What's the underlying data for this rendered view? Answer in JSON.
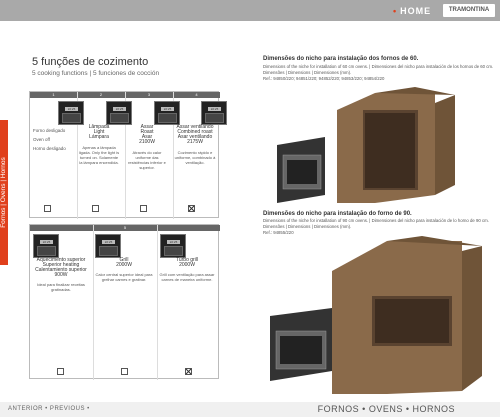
{
  "header": {
    "home_label": "HOME",
    "brand": "TRAMONTINA"
  },
  "side_tab": "Fornos | Ovens | Hornos",
  "section": {
    "title": "5 funções de cozimento",
    "subtitle": "5 cooking functions | 5 funciones de cocción"
  },
  "grid1": {
    "columns": [
      "1",
      "2",
      "3",
      "4"
    ],
    "functions": [
      {
        "name": "Lâmpada",
        "name_en": "Light",
        "name_es": "Lámpara",
        "power": "",
        "desc": "Apenas a lâmpada ligada. Only the light is turned on. Solamente la lámpara encendida."
      },
      {
        "name": "Assar",
        "name_en": "Roast",
        "name_es": "Asar",
        "power": "2100W",
        "desc": "Através do calor uniforme das resistências inferior e superior."
      },
      {
        "name": "Assar ventilando",
        "name_en": "Combined roast",
        "name_es": "Asar ventilando",
        "power": "2175W",
        "desc": "Cozimento rápido e uniforme, combinado à ventilação."
      },
      {
        "name": "",
        "name_en": "",
        "name_es": "",
        "power": "",
        "desc": ""
      }
    ],
    "row_labels": [
      "Forno desligado",
      "Oven off",
      "Horno desligado"
    ]
  },
  "grid2": {
    "columns": [
      "5"
    ],
    "functions": [
      {
        "name": "Aquecimento superior",
        "name_en": "Superior heating",
        "name_es": "Calentamiento superior",
        "power": "900W",
        "desc": "Ideal para finalizar receitas gratinadas."
      },
      {
        "name": "Grill",
        "name_en": "",
        "name_es": "",
        "power": "2000W",
        "desc": "Calor central superior ideal para grelhar carnes e gratinar."
      },
      {
        "name": "Turbo grill",
        "name_en": "",
        "name_es": "",
        "power": "2000W",
        "desc": "Grill com ventilação para assar carnes de maneira uniforme."
      }
    ]
  },
  "right": {
    "sec1_title": "Dimensões do nicho para instalação dos fornos de 60.",
    "sec1_sub": "Dimensions of the niche for installation of 60 cm ovens. | Dimensiones del nicho para instalación de los hornos de 60 cm.",
    "sec1_dim": "Dimensões | Dimensions | Dimensiones (mm).",
    "sec1_ref": "Ref.: 94850/220; 94851/220; 94852/220; 94853/220; 94854/220",
    "sec2_title": "Dimensões do nicho para instalação do forno de 90.",
    "sec2_sub": "Dimensions of the niche for installation of 90 cm ovens. | Dimensiones del nicho para instalación de lo horno de 90 cm.",
    "sec2_dim": "Dimensões | Dimensions | Dimensiones (mm).",
    "sec2_ref": "Ref.: 94855/220"
  },
  "footer": {
    "left": "ANTERIOR • PREVIOUS •",
    "right": "FORNOS • OVENS • HORNOS"
  }
}
